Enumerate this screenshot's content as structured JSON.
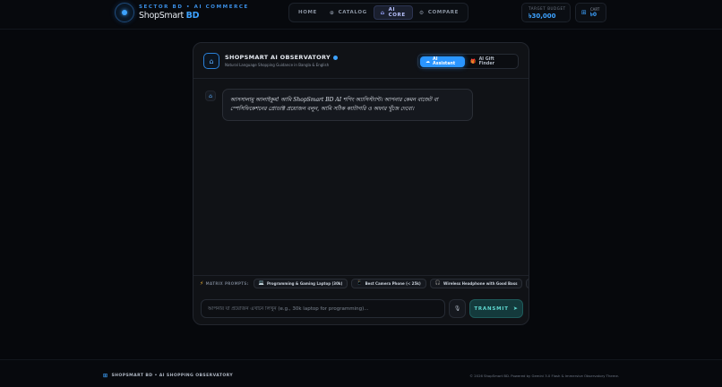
{
  "brand": {
    "sector": "SECTOR BD • AI COMMERCE",
    "name_main": "ShopSmart ",
    "name_accent": "BD",
    "logo_icon": "orb-icon"
  },
  "nav": {
    "items": [
      {
        "label": "HOME",
        "icon": "",
        "active": false
      },
      {
        "label": "CATALOG",
        "icon": "⊕",
        "active": false
      },
      {
        "label": "AI CORE",
        "icon": "⌂",
        "active": true
      },
      {
        "label": "COMPARE",
        "icon": "⚙",
        "active": false
      }
    ]
  },
  "budget": {
    "label": "TARGET BUDGET",
    "value": "৳30,000"
  },
  "cart": {
    "label": "CART",
    "count": "৳0"
  },
  "panel": {
    "title": "SHOPSMART AI OBSERVATORY",
    "subtitle": "Natural Language Shopping Guidance in Bangla & English",
    "modes": [
      {
        "label": "AI Assistant",
        "icon": "☁",
        "active": true
      },
      {
        "label": "AI Gift Finder",
        "icon": "🎁",
        "active": false
      }
    ]
  },
  "chat": {
    "messages": [
      {
        "sender": "bot",
        "text": "আসসালামু আলাইকুম! আমি ShopSmart BD AI শপিং অ্যাসিস্ট্যান্ট। আপনার কেমন বাজেট বা স্পেসিফিকেশনের প্রোডাক্ট প্রয়োজন বলুন, আমি সঠিক ক্যাটাগরি ও অফার খুঁজে দেবো।"
      }
    ]
  },
  "prompts": {
    "label": "MATRIX PROMPTS:",
    "chips": [
      {
        "icon": "💻",
        "label": "Programming & Gaming Laptop (30k)"
      },
      {
        "icon": "📱",
        "label": "Best Camera Phone (< 25k)"
      },
      {
        "icon": "🎧",
        "label": "Wireless Headphone with Good Bass"
      },
      {
        "icon": "⌚",
        "label": ""
      }
    ]
  },
  "input": {
    "placeholder": "আপনার যা প্রয়োজন এখানে লিখুন (e.g., 30k laptop for programming)...",
    "value": "",
    "send_label": "TRANSMIT"
  },
  "footer": {
    "left": "SHOPSMART BD • AI SHOPPING OBSERVATORY",
    "right": "© 2026 ShopSmart BD. Powered by Gemini 3.0 Flash & Immersive Observatory Theme."
  },
  "colors": {
    "accent": "#3da2ff",
    "send": "#5fd8d0",
    "background": "#06080c"
  }
}
